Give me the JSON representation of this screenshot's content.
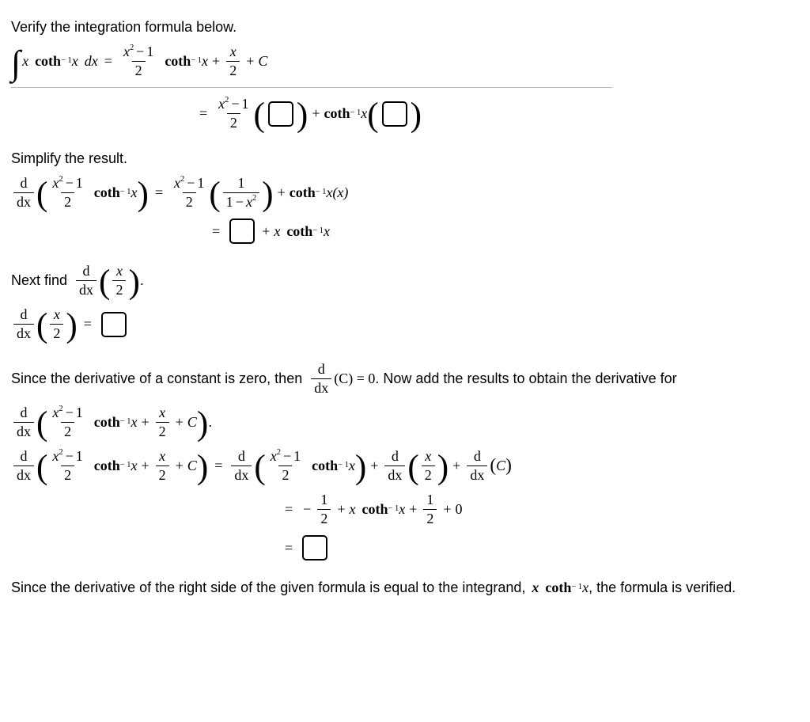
{
  "intro": "Verify the integration formula below.",
  "simplify_heading": "Simplify the result.",
  "nextfind_prefix": "Next find",
  "paragraph_since_prefix": "Since the derivative of a constant is zero, then",
  "paragraph_since_suffix": ". Now add the results to obtain the derivative for",
  "final_sentence_a": "Since the derivative of the right side of the given formula is equal to the integrand,",
  "final_sentence_b": ", the formula is verified.",
  "sym": {
    "integral": "∫",
    "x": "x",
    "coth": "coth",
    "dx": "dx",
    "d": "d",
    "C": "C",
    "zero": "0",
    "one": "1",
    "two": "2",
    "minus1": "− 1",
    "eq": "=",
    "plus": "+",
    "minus": "−",
    "xpow2": "x",
    "pow2": "2",
    "ddx_num": "d",
    "ddx_den": "dx",
    "x_of_x": "x(x)",
    "C_eq_zero": "(C) = 0",
    "period": "."
  },
  "chart_data": null
}
